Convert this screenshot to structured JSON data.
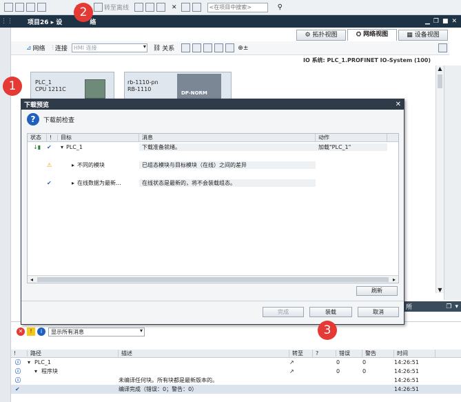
{
  "toolbar": {
    "online_label": "在线",
    "offline_label": "转至离线",
    "search_placeholder": "<在项目中搜索>"
  },
  "project_bar": {
    "title": "项目26 ▸ 设",
    "title_tail": "络"
  },
  "view_tabs": [
    "拓扑视图",
    "网络视图",
    "设备视图"
  ],
  "net_toolbar": {
    "network_label": "网络",
    "connect_label": "连接",
    "hmi_select": "HMI 连接",
    "relation_label": "关系"
  },
  "io_system_label": "IO 系统: PLC_1.PROFINET IO-System (100)",
  "devices": [
    {
      "name": "PLC_1",
      "type": "CPU 1211C"
    },
    {
      "name": "rb-1110-pn",
      "type": "RB-1110",
      "module": "DP-NORM"
    }
  ],
  "dialog": {
    "title": "下载预览",
    "heading": "下载前检查",
    "columns": [
      "状态",
      "!",
      "目标",
      "消息",
      "动作"
    ],
    "rows": [
      {
        "target": "PLC_1",
        "message": "下载准备就绪。",
        "action": "加载\"PLC_1\""
      },
      {
        "target": "不同的模块",
        "message": "已组态模块与目标模块（在线）之间的差异",
        "action": ""
      },
      {
        "target": "在线数据为最新...",
        "message": "在线状态是最新的，将不会装载组态。",
        "action": ""
      }
    ],
    "refresh_label": "刷新",
    "finish_label": "完成",
    "load_label": "装载",
    "cancel_label": "取消"
  },
  "markers": [
    "1",
    "2",
    "3"
  ],
  "info_panel": {
    "filter_select": "显示所有消息",
    "columns": [
      "!",
      "路径",
      "描述",
      "转至",
      "?",
      "错误",
      "警告",
      "时间"
    ],
    "rows": [
      {
        "path": "PLC_1",
        "desc": "",
        "goto": "↗",
        "errors": "0",
        "warnings": "0",
        "time": "14:26:51"
      },
      {
        "path": "程序块",
        "desc": "",
        "goto": "↗",
        "errors": "0",
        "warnings": "0",
        "time": "14:26:51"
      },
      {
        "path": "",
        "desc": "未编译任何块。所有块都是最新版本的。",
        "goto": "",
        "errors": "",
        "warnings": "",
        "time": "14:26:51"
      },
      {
        "path": "",
        "desc": "编译完成（错误：0；警告：0）",
        "goto": "",
        "errors": "",
        "warnings": "",
        "time": "14:26:51"
      }
    ]
  },
  "colors": {
    "marker_red": "#e53935",
    "title_bar": "#1f3347",
    "dialog_title": "#2f3b49",
    "info_blue": "#1f5fbf"
  }
}
